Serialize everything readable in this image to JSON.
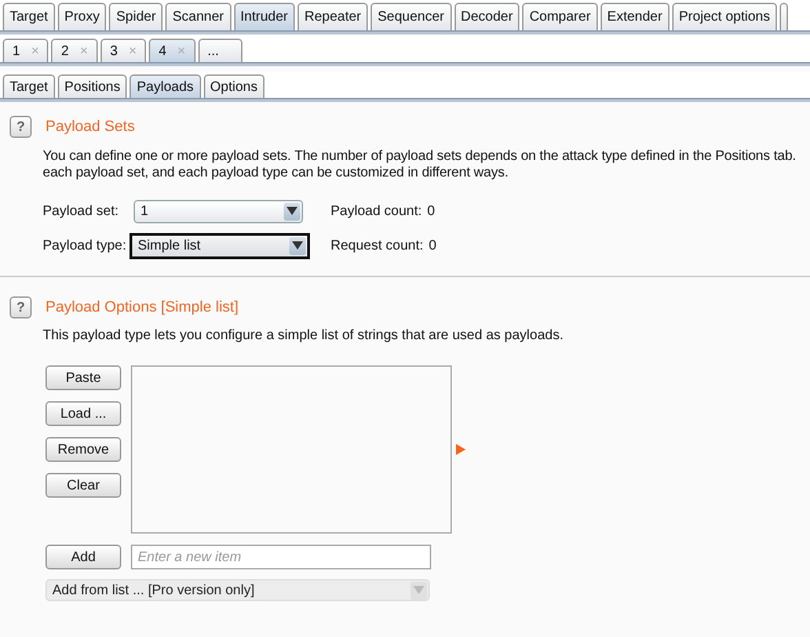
{
  "main_tabs": [
    {
      "label": "Target",
      "selected": false
    },
    {
      "label": "Proxy",
      "selected": false
    },
    {
      "label": "Spider",
      "selected": false
    },
    {
      "label": "Scanner",
      "selected": false
    },
    {
      "label": "Intruder",
      "selected": true
    },
    {
      "label": "Repeater",
      "selected": false
    },
    {
      "label": "Sequencer",
      "selected": false
    },
    {
      "label": "Decoder",
      "selected": false
    },
    {
      "label": "Comparer",
      "selected": false
    },
    {
      "label": "Extender",
      "selected": false
    },
    {
      "label": "Project options",
      "selected": false
    }
  ],
  "attack_tabs": [
    {
      "label": "1",
      "close": "×",
      "selected": false
    },
    {
      "label": "2",
      "close": "×",
      "selected": false
    },
    {
      "label": "3",
      "close": "×",
      "selected": false
    },
    {
      "label": "4",
      "close": "×",
      "selected": true
    },
    {
      "label": "...",
      "selected": false
    }
  ],
  "sub_tabs": [
    {
      "label": "Target",
      "selected": false
    },
    {
      "label": "Positions",
      "selected": false
    },
    {
      "label": "Payloads",
      "selected": true
    },
    {
      "label": "Options",
      "selected": false
    }
  ],
  "payload_sets": {
    "help_icon": "?",
    "title": "Payload Sets",
    "description": [
      "You can define one or more payload sets. The number of payload sets depends on the attack type defined in the Positions tab.",
      "each payload set, and each payload type can be customized in different ways."
    ],
    "fields": [
      {
        "label": "Payload set:",
        "value": "1",
        "focused": false,
        "info_label": "Payload count:",
        "info_value": "0"
      },
      {
        "label": "Payload type:",
        "value": "Simple list",
        "focused": true,
        "info_label": "Request count:",
        "info_value": "0"
      }
    ]
  },
  "payload_options": {
    "help_icon": "?",
    "title": "Payload Options [Simple list]",
    "description": "This payload type lets you configure a simple list of strings that are used as payloads.",
    "buttons": [
      "Paste",
      "Load ...",
      "Remove",
      "Clear"
    ],
    "add_button": "Add",
    "new_item": {
      "placeholder": "Enter a new item"
    },
    "add_from_list": {
      "value": "Add from list ... [Pro version only]",
      "disabled": true
    }
  }
}
